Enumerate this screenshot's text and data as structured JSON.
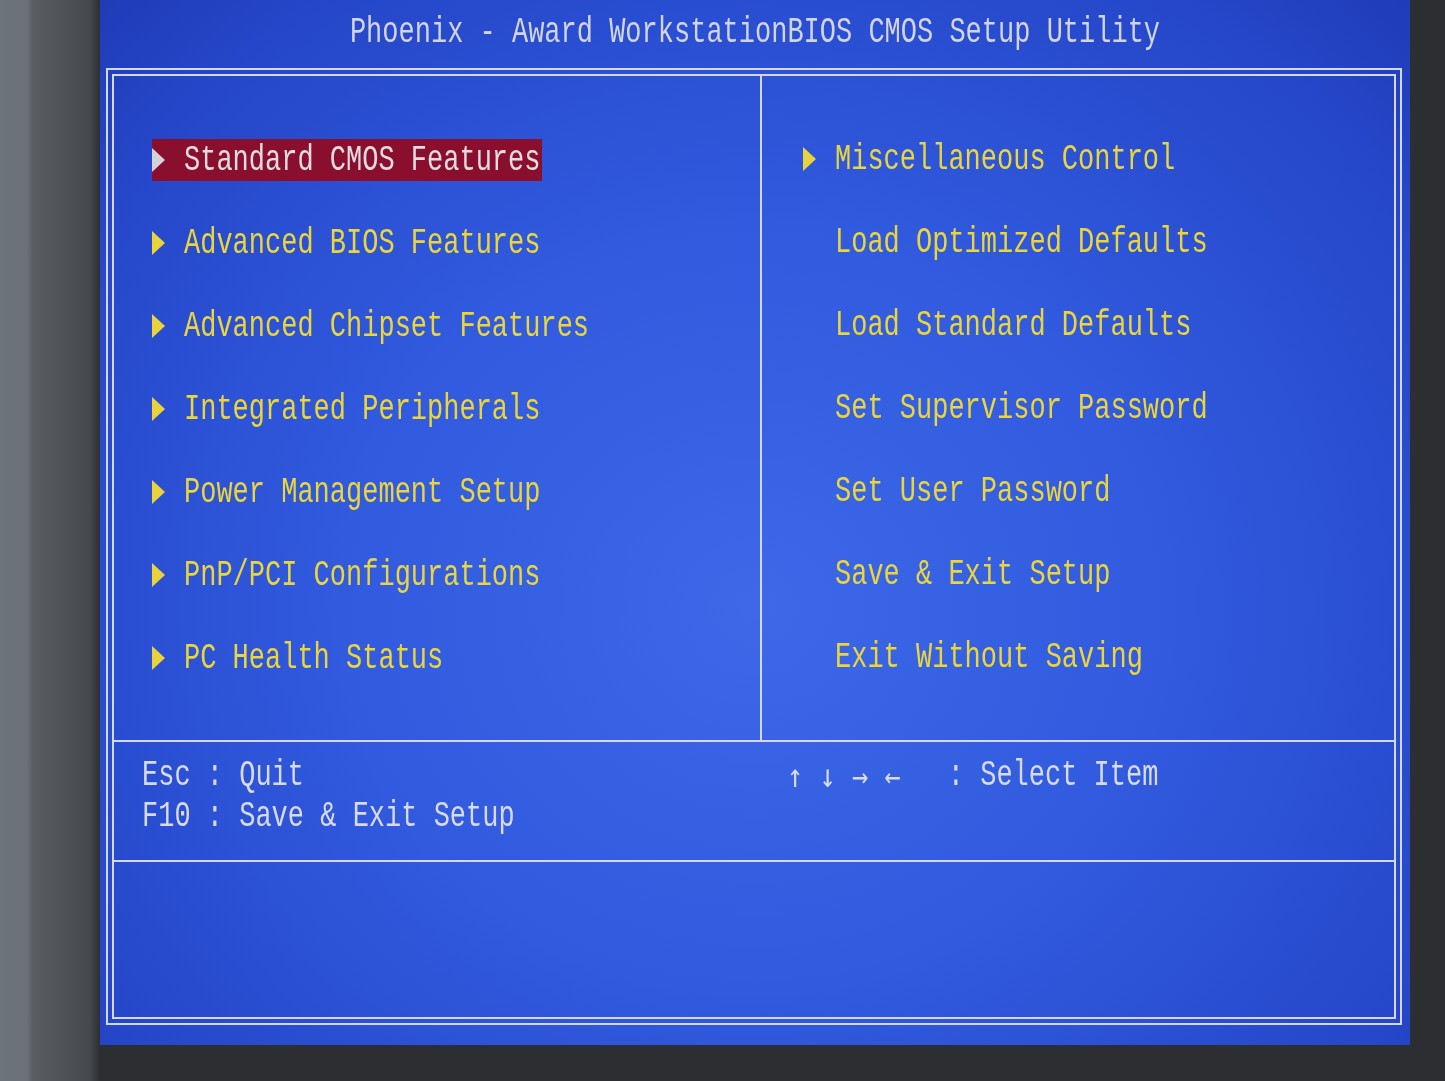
{
  "title": "Phoenix - Award WorkstationBIOS CMOS Setup Utility",
  "menu": {
    "left": [
      {
        "label": "Standard CMOS Features",
        "submenu": true,
        "selected": true
      },
      {
        "label": "Advanced BIOS Features",
        "submenu": true,
        "selected": false
      },
      {
        "label": "Advanced Chipset Features",
        "submenu": true,
        "selected": false
      },
      {
        "label": "Integrated Peripherals",
        "submenu": true,
        "selected": false
      },
      {
        "label": "Power Management Setup",
        "submenu": true,
        "selected": false
      },
      {
        "label": "PnP/PCI Configurations",
        "submenu": true,
        "selected": false
      },
      {
        "label": "PC Health Status",
        "submenu": true,
        "selected": false
      }
    ],
    "right": [
      {
        "label": "Miscellaneous Control",
        "submenu": true,
        "selected": false
      },
      {
        "label": "Load Optimized Defaults",
        "submenu": false,
        "selected": false
      },
      {
        "label": "Load Standard Defaults",
        "submenu": false,
        "selected": false
      },
      {
        "label": "Set Supervisor Password",
        "submenu": false,
        "selected": false
      },
      {
        "label": "Set User Password",
        "submenu": false,
        "selected": false
      },
      {
        "label": "Save & Exit Setup",
        "submenu": false,
        "selected": false
      },
      {
        "label": "Exit Without Saving",
        "submenu": false,
        "selected": false
      }
    ]
  },
  "help": {
    "left": [
      "Esc : Quit",
      "F10 : Save & Exit Setup"
    ],
    "right": [
      {
        "keys": "↑ ↓ → ←",
        "action": ": Select Item"
      }
    ]
  }
}
